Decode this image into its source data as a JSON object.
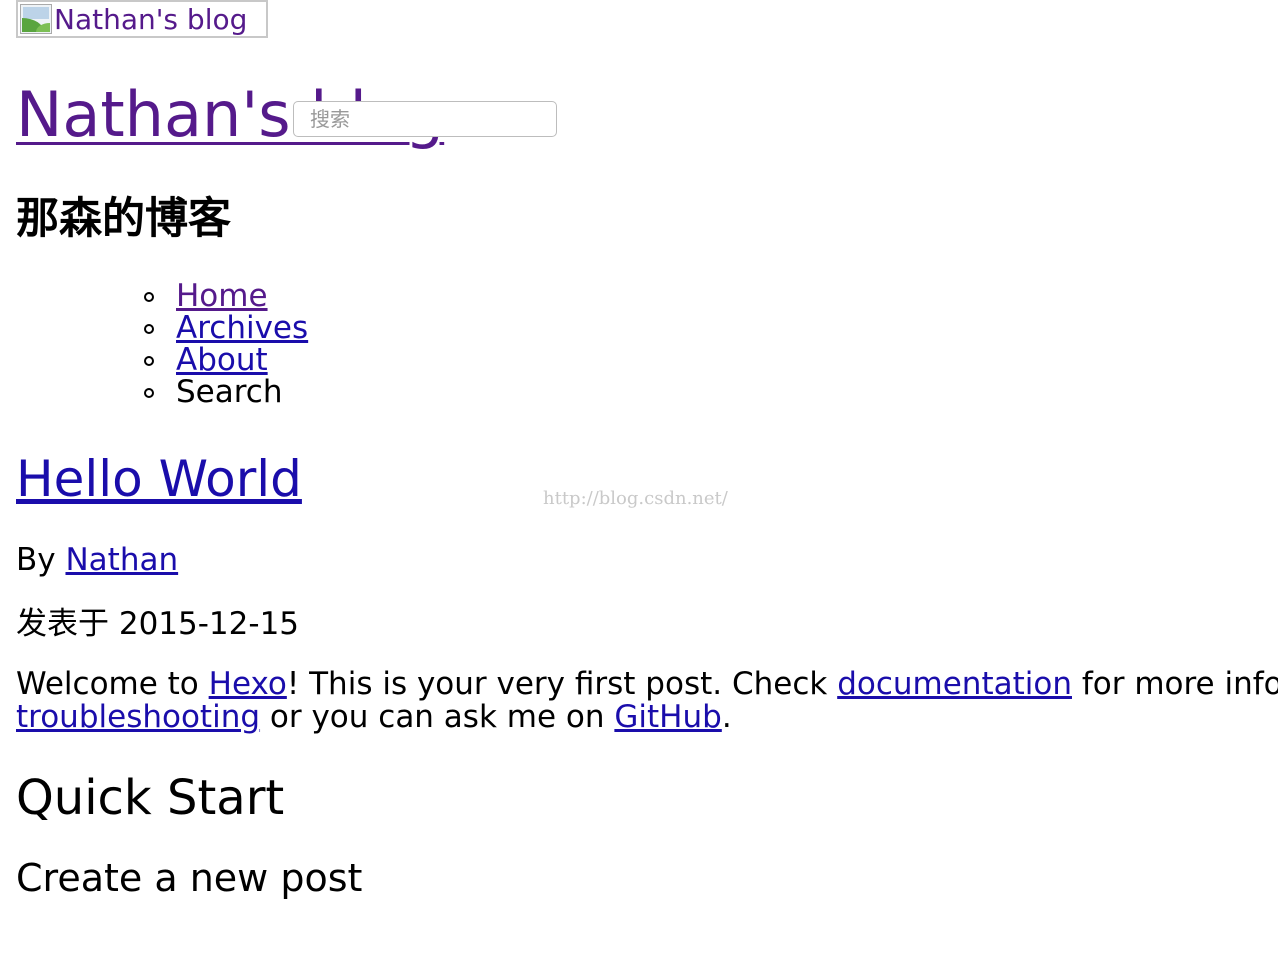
{
  "header": {
    "logo_alt": "Nathan's blog",
    "site_title": "Nathan's blog",
    "subtitle": "那森的博客"
  },
  "nav": {
    "items": [
      {
        "label": "Home"
      },
      {
        "label": "Archives"
      },
      {
        "label": "About"
      }
    ],
    "search_label": "Search",
    "search_placeholder": "搜索"
  },
  "watermark": "http://blog.csdn.net/",
  "post": {
    "title": "Hello World",
    "by_prefix": "By",
    "author": "Nathan",
    "posted_label": "发表于 2015-12-15",
    "para": {
      "t1": "Welcome to",
      "link_hexo": "Hexo",
      "t2": "! This is your very first post. Check",
      "link_docs": "documentation",
      "t3": "for more info. If",
      "link_trouble": "troubleshooting",
      "t4": "or you can ask me on",
      "link_github": "GitHub",
      "t5": "."
    },
    "heading_quick_start": "Quick Start",
    "heading_create_post": "Create a new post"
  },
  "colors": {
    "visited_link": "#551a8b",
    "link": "#1a0dab"
  }
}
